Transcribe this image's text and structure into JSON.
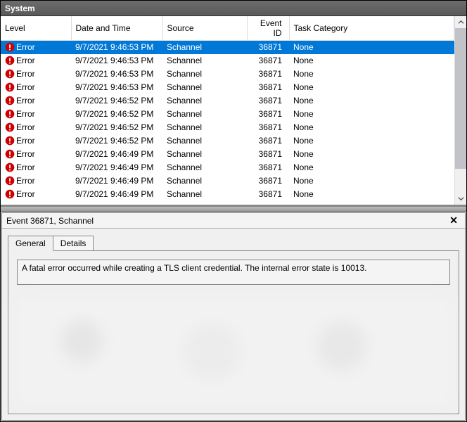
{
  "window": {
    "title": "System"
  },
  "columns": {
    "level": "Level",
    "datetime": "Date and Time",
    "source": "Source",
    "eventid": "Event ID",
    "category": "Task Category"
  },
  "rows": [
    {
      "level": "Error",
      "datetime": "9/7/2021 9:46:53 PM",
      "source": "Schannel",
      "eventid": "36871",
      "category": "None",
      "selected": true
    },
    {
      "level": "Error",
      "datetime": "9/7/2021 9:46:53 PM",
      "source": "Schannel",
      "eventid": "36871",
      "category": "None"
    },
    {
      "level": "Error",
      "datetime": "9/7/2021 9:46:53 PM",
      "source": "Schannel",
      "eventid": "36871",
      "category": "None"
    },
    {
      "level": "Error",
      "datetime": "9/7/2021 9:46:53 PM",
      "source": "Schannel",
      "eventid": "36871",
      "category": "None"
    },
    {
      "level": "Error",
      "datetime": "9/7/2021 9:46:52 PM",
      "source": "Schannel",
      "eventid": "36871",
      "category": "None"
    },
    {
      "level": "Error",
      "datetime": "9/7/2021 9:46:52 PM",
      "source": "Schannel",
      "eventid": "36871",
      "category": "None"
    },
    {
      "level": "Error",
      "datetime": "9/7/2021 9:46:52 PM",
      "source": "Schannel",
      "eventid": "36871",
      "category": "None"
    },
    {
      "level": "Error",
      "datetime": "9/7/2021 9:46:52 PM",
      "source": "Schannel",
      "eventid": "36871",
      "category": "None"
    },
    {
      "level": "Error",
      "datetime": "9/7/2021 9:46:49 PM",
      "source": "Schannel",
      "eventid": "36871",
      "category": "None"
    },
    {
      "level": "Error",
      "datetime": "9/7/2021 9:46:49 PM",
      "source": "Schannel",
      "eventid": "36871",
      "category": "None"
    },
    {
      "level": "Error",
      "datetime": "9/7/2021 9:46:49 PM",
      "source": "Schannel",
      "eventid": "36871",
      "category": "None"
    },
    {
      "level": "Error",
      "datetime": "9/7/2021 9:46:49 PM",
      "source": "Schannel",
      "eventid": "36871",
      "category": "None"
    }
  ],
  "detail": {
    "header": "Event 36871, Schannel",
    "tabs": {
      "general": "General",
      "details": "Details"
    },
    "message": "A fatal error occurred while creating a TLS client credential. The internal error state is 10013."
  }
}
